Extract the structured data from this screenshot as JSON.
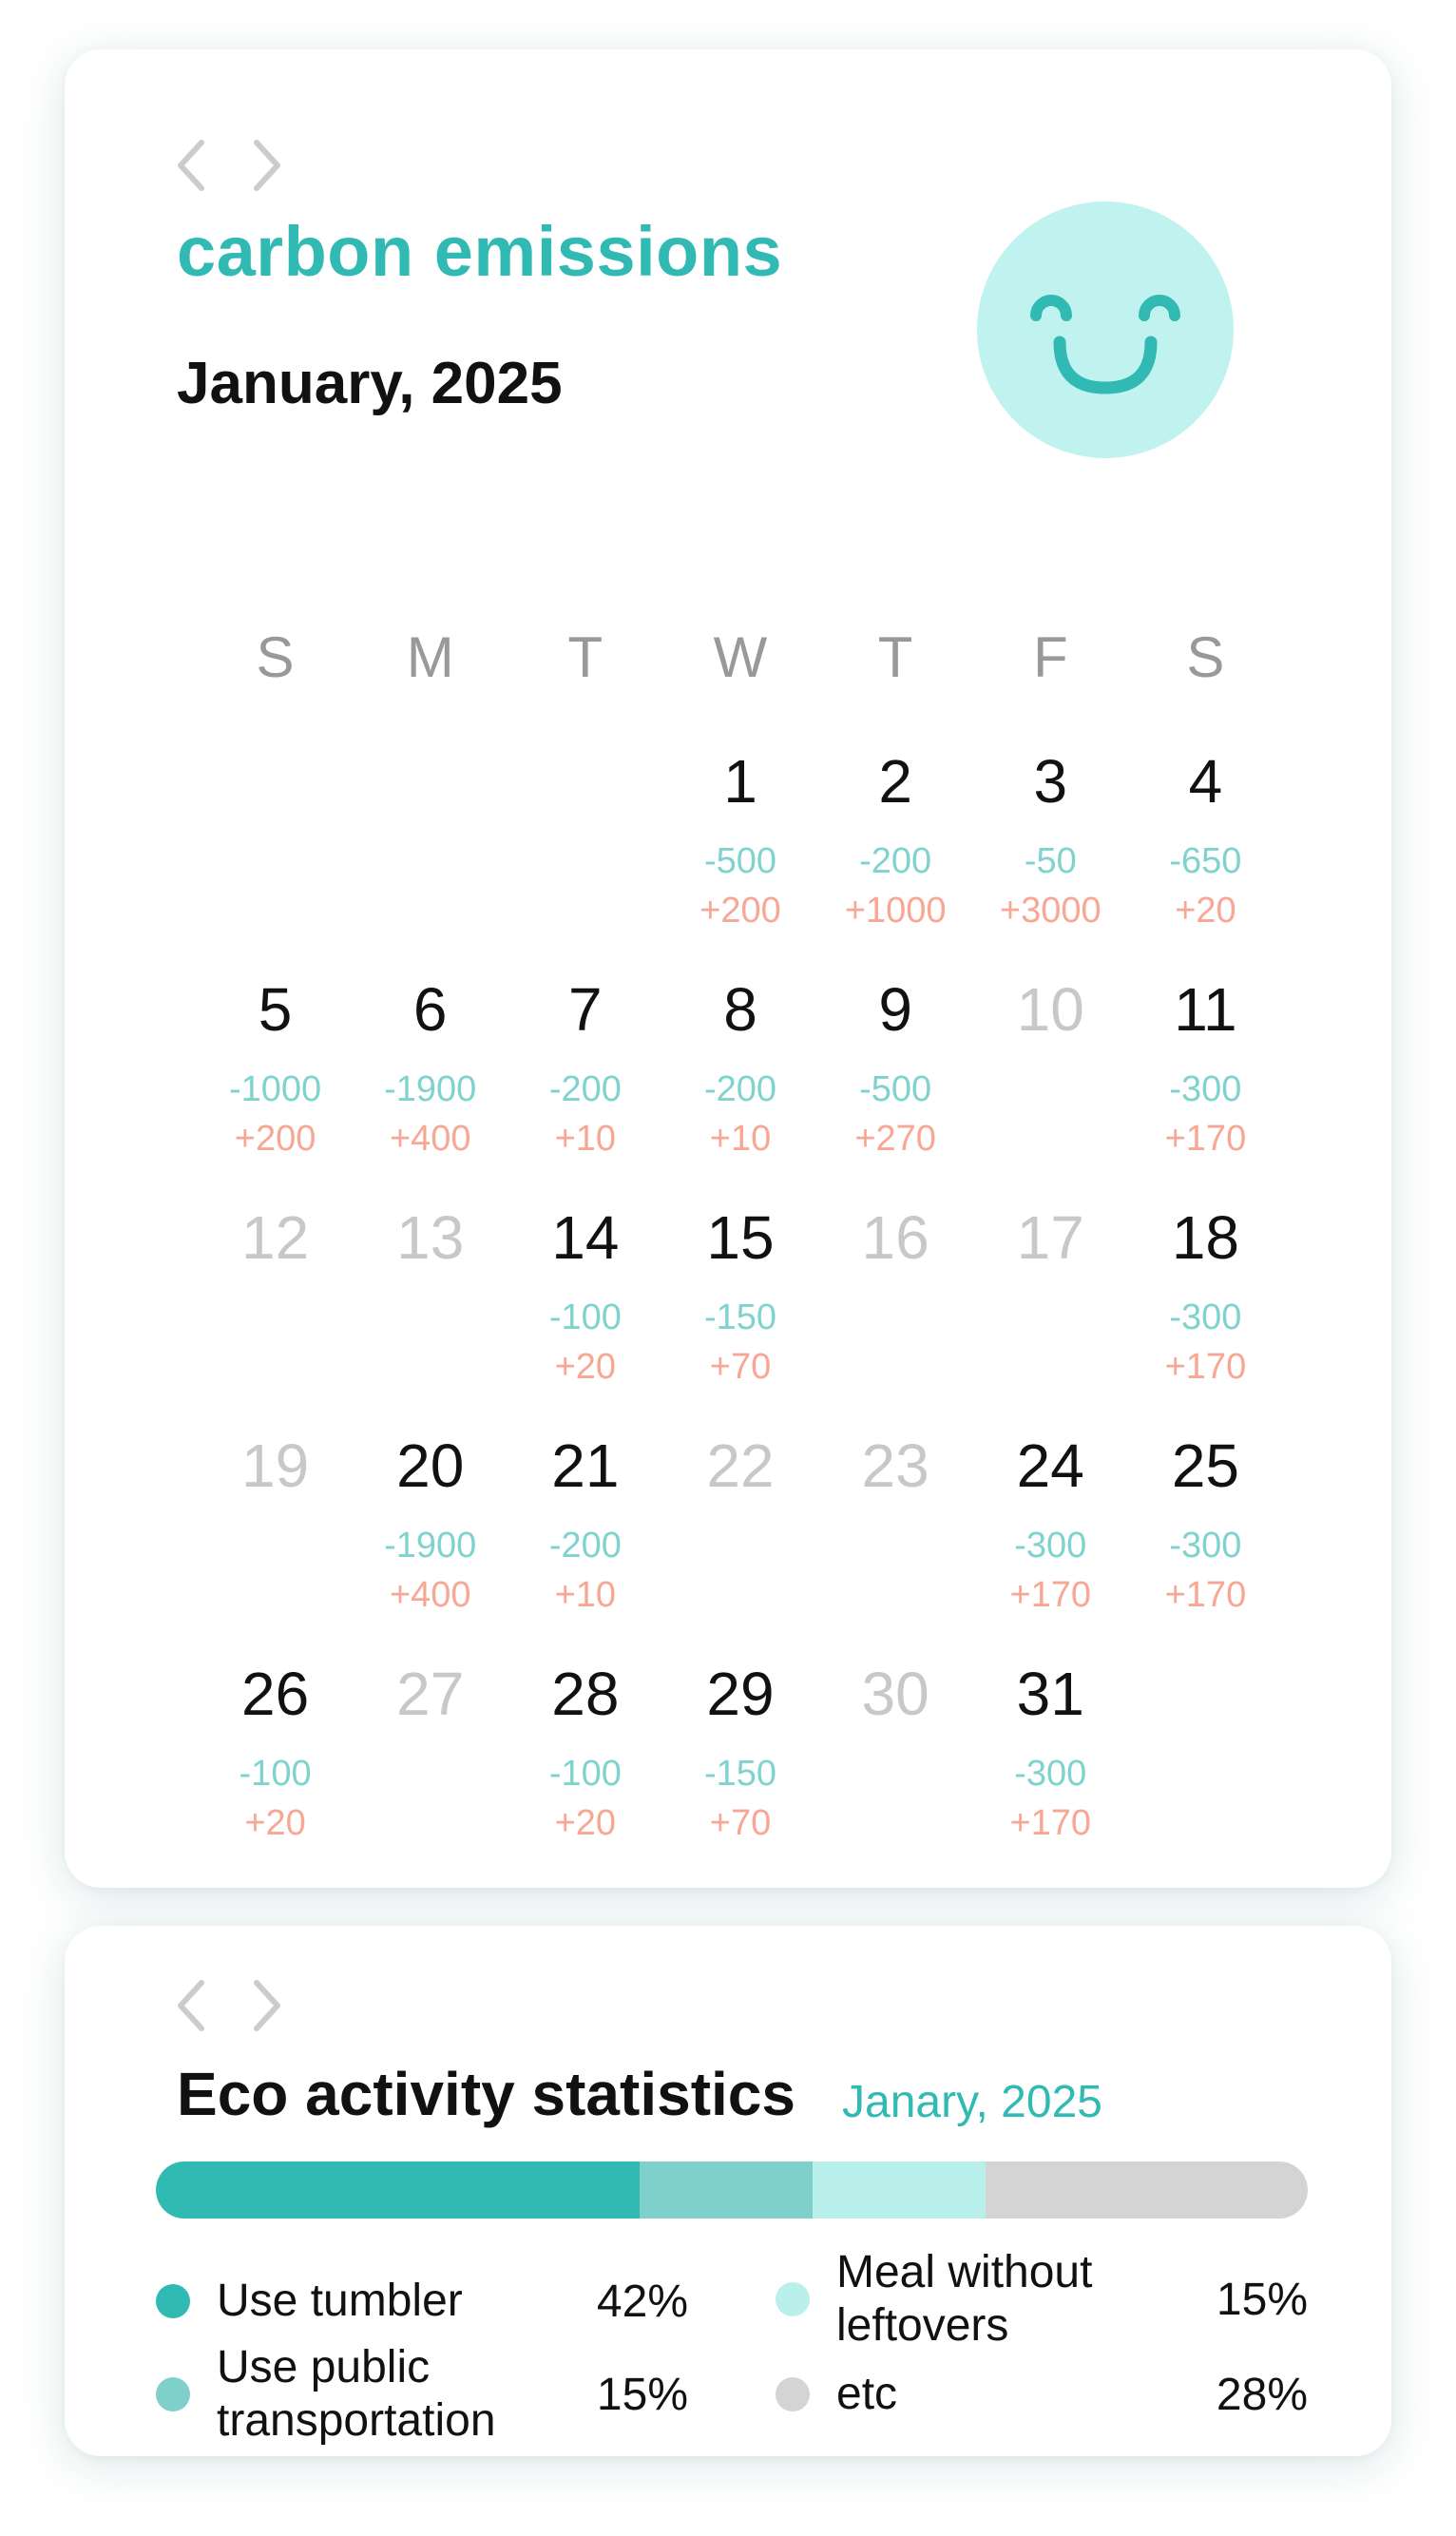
{
  "calendar": {
    "title": "carbon emissions",
    "month_label": "January, 2025",
    "mood": "smiling-face",
    "weekdays": [
      "S",
      "M",
      "T",
      "W",
      "T",
      "F",
      "S"
    ],
    "first_weekday_index": 3,
    "days": [
      {
        "day": "1",
        "active": true,
        "minus": "-500",
        "plus": "+200"
      },
      {
        "day": "2",
        "active": true,
        "minus": "-200",
        "plus": "+1000"
      },
      {
        "day": "3",
        "active": true,
        "minus": "-50",
        "plus": "+3000"
      },
      {
        "day": "4",
        "active": true,
        "minus": "-650",
        "plus": "+20"
      },
      {
        "day": "5",
        "active": true,
        "minus": "-1000",
        "plus": "+200"
      },
      {
        "day": "6",
        "active": true,
        "minus": "-1900",
        "plus": "+400"
      },
      {
        "day": "7",
        "active": true,
        "minus": "-200",
        "plus": "+10"
      },
      {
        "day": "8",
        "active": true,
        "minus": "-200",
        "plus": "+10"
      },
      {
        "day": "9",
        "active": true,
        "minus": "-500",
        "plus": "+270"
      },
      {
        "day": "10",
        "active": false,
        "minus": "",
        "plus": ""
      },
      {
        "day": "11",
        "active": true,
        "minus": "-300",
        "plus": "+170"
      },
      {
        "day": "12",
        "active": false,
        "minus": "",
        "plus": ""
      },
      {
        "day": "13",
        "active": false,
        "minus": "",
        "plus": ""
      },
      {
        "day": "14",
        "active": true,
        "minus": "-100",
        "plus": "+20"
      },
      {
        "day": "15",
        "active": true,
        "minus": "-150",
        "plus": "+70"
      },
      {
        "day": "16",
        "active": false,
        "minus": "",
        "plus": ""
      },
      {
        "day": "17",
        "active": false,
        "minus": "",
        "plus": ""
      },
      {
        "day": "18",
        "active": true,
        "minus": "-300",
        "plus": "+170"
      },
      {
        "day": "19",
        "active": false,
        "minus": "",
        "plus": ""
      },
      {
        "day": "20",
        "active": true,
        "minus": "-1900",
        "plus": "+400"
      },
      {
        "day": "21",
        "active": true,
        "minus": "-200",
        "plus": "+10"
      },
      {
        "day": "22",
        "active": false,
        "minus": "",
        "plus": ""
      },
      {
        "day": "23",
        "active": false,
        "minus": "",
        "plus": ""
      },
      {
        "day": "24",
        "active": true,
        "minus": "-300",
        "plus": "+170"
      },
      {
        "day": "25",
        "active": true,
        "minus": "-300",
        "plus": "+170"
      },
      {
        "day": "26",
        "active": true,
        "minus": "-100",
        "plus": "+20"
      },
      {
        "day": "27",
        "active": false,
        "minus": "",
        "plus": ""
      },
      {
        "day": "28",
        "active": true,
        "minus": "-100",
        "plus": "+20"
      },
      {
        "day": "29",
        "active": true,
        "minus": "-150",
        "plus": "+70"
      },
      {
        "day": "30",
        "active": false,
        "minus": "",
        "plus": ""
      },
      {
        "day": "31",
        "active": true,
        "minus": "-300",
        "plus": "+170"
      }
    ]
  },
  "stats": {
    "title": "Eco activity statistics",
    "month_label": "Janary, 2025",
    "items": [
      {
        "label": "Use tumbler",
        "percent": "42%",
        "value": 42,
        "color": "#31bab3"
      },
      {
        "label": "Use public transportation",
        "percent": "15%",
        "value": 15,
        "color": "#7fd0cb"
      },
      {
        "label": "Meal without leftovers",
        "percent": "15%",
        "value": 15,
        "color": "#b9f0ec"
      },
      {
        "label": "etc",
        "percent": "28%",
        "value": 28,
        "color": "#d4d4d4"
      }
    ]
  },
  "colors": {
    "accent": "#31bab3",
    "minus": "#7fd3cf",
    "plus": "#f7a793",
    "inactive_day": "#c8c8c8",
    "face": "#c0f2ef"
  }
}
